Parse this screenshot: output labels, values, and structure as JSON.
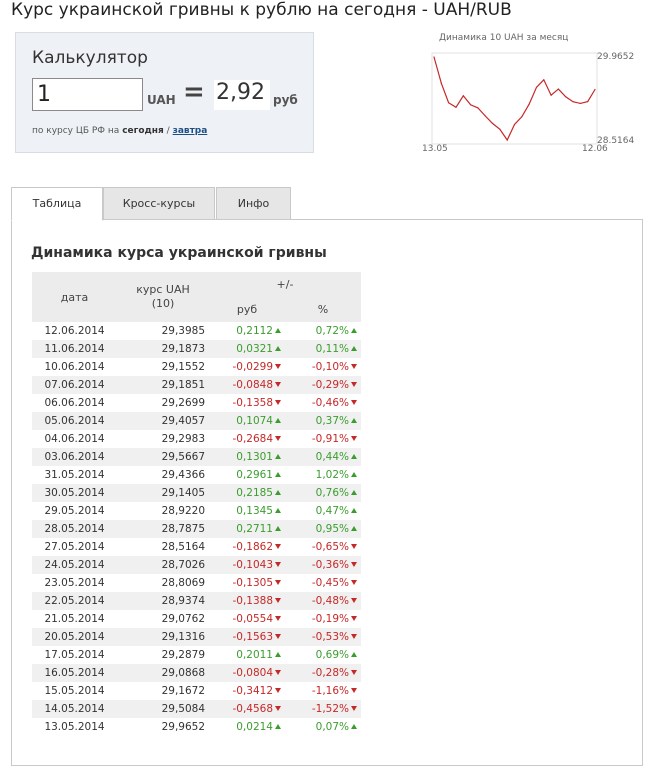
{
  "page": {
    "title": "Курс украинской гривны к рублю на сегодня - UAH/RUB"
  },
  "calculator": {
    "title": "Калькулятор",
    "input_value": "1",
    "from_currency": "UAH",
    "equals": "=",
    "result": "2,92",
    "to_currency": "руб",
    "note_prefix": "по курсу ЦБ РФ на",
    "note_today": "сегодня",
    "note_sep": "/",
    "note_tomorrow_link": "завтра"
  },
  "mini_chart": {
    "title": "Динамика 10 UAH за месяц",
    "y_max_label": "29.9652",
    "y_min_label": "28.5164",
    "x_start_label": "13.05",
    "x_end_label": "12.06",
    "line_color": "#c62828"
  },
  "chart_data": {
    "type": "line",
    "title": "Динамика 10 UAH за месяц",
    "x": [
      "13.05.2014",
      "14.05.2014",
      "15.05.2014",
      "16.05.2014",
      "17.05.2014",
      "20.05.2014",
      "21.05.2014",
      "22.05.2014",
      "23.05.2014",
      "24.05.2014",
      "27.05.2014",
      "28.05.2014",
      "29.05.2014",
      "30.05.2014",
      "31.05.2014",
      "03.06.2014",
      "04.06.2014",
      "05.06.2014",
      "06.06.2014",
      "07.06.2014",
      "10.06.2014",
      "11.06.2014",
      "12.06.2014"
    ],
    "series": [
      {
        "values": [
          29.9652,
          29.5084,
          29.1672,
          29.0868,
          29.2879,
          29.1316,
          29.0762,
          28.9374,
          28.8069,
          28.7026,
          28.5164,
          28.7875,
          28.922,
          29.1405,
          29.4366,
          29.5667,
          29.2983,
          29.4057,
          29.2699,
          29.1851,
          29.1552,
          29.1873,
          29.3985
        ]
      }
    ],
    "ylim": [
      28.5164,
      29.9652
    ],
    "y_tick_labels": [
      "29.9652",
      "28.5164"
    ],
    "x_tick_labels": [
      "13.05",
      "12.06"
    ]
  },
  "tabs": [
    {
      "label": "Таблица",
      "active": true
    },
    {
      "label": "Кросс-курсы",
      "active": false
    },
    {
      "label": "Инфо",
      "active": false
    }
  ],
  "table": {
    "heading": "Динамика курса украинской гривны",
    "col_date": "дата",
    "col_rate_line1": "курс UAH",
    "col_rate_line2": "(10)",
    "col_change": "+/-",
    "col_rub": "руб",
    "col_pct": "%",
    "rows": [
      {
        "date": "12.06.2014",
        "rate": "29,3985",
        "rub": "0,2112",
        "pct": "0,72%",
        "dir": "up"
      },
      {
        "date": "11.06.2014",
        "rate": "29,1873",
        "rub": "0,0321",
        "pct": "0,11%",
        "dir": "up"
      },
      {
        "date": "10.06.2014",
        "rate": "29,1552",
        "rub": "-0,0299",
        "pct": "-0,10%",
        "dir": "down"
      },
      {
        "date": "07.06.2014",
        "rate": "29,1851",
        "rub": "-0,0848",
        "pct": "-0,29%",
        "dir": "down"
      },
      {
        "date": "06.06.2014",
        "rate": "29,2699",
        "rub": "-0,1358",
        "pct": "-0,46%",
        "dir": "down"
      },
      {
        "date": "05.06.2014",
        "rate": "29,4057",
        "rub": "0,1074",
        "pct": "0,37%",
        "dir": "up"
      },
      {
        "date": "04.06.2014",
        "rate": "29,2983",
        "rub": "-0,2684",
        "pct": "-0,91%",
        "dir": "down"
      },
      {
        "date": "03.06.2014",
        "rate": "29,5667",
        "rub": "0,1301",
        "pct": "0,44%",
        "dir": "up"
      },
      {
        "date": "31.05.2014",
        "rate": "29,4366",
        "rub": "0,2961",
        "pct": "1,02%",
        "dir": "up"
      },
      {
        "date": "30.05.2014",
        "rate": "29,1405",
        "rub": "0,2185",
        "pct": "0,76%",
        "dir": "up"
      },
      {
        "date": "29.05.2014",
        "rate": "28,9220",
        "rub": "0,1345",
        "pct": "0,47%",
        "dir": "up"
      },
      {
        "date": "28.05.2014",
        "rate": "28,7875",
        "rub": "0,2711",
        "pct": "0,95%",
        "dir": "up"
      },
      {
        "date": "27.05.2014",
        "rate": "28,5164",
        "rub": "-0,1862",
        "pct": "-0,65%",
        "dir": "down"
      },
      {
        "date": "24.05.2014",
        "rate": "28,7026",
        "rub": "-0,1043",
        "pct": "-0,36%",
        "dir": "down"
      },
      {
        "date": "23.05.2014",
        "rate": "28,8069",
        "rub": "-0,1305",
        "pct": "-0,45%",
        "dir": "down"
      },
      {
        "date": "22.05.2014",
        "rate": "28,9374",
        "rub": "-0,1388",
        "pct": "-0,48%",
        "dir": "down"
      },
      {
        "date": "21.05.2014",
        "rate": "29,0762",
        "rub": "-0,0554",
        "pct": "-0,19%",
        "dir": "down"
      },
      {
        "date": "20.05.2014",
        "rate": "29,1316",
        "rub": "-0,1563",
        "pct": "-0,53%",
        "dir": "down"
      },
      {
        "date": "17.05.2014",
        "rate": "29,2879",
        "rub": "0,2011",
        "pct": "0,69%",
        "dir": "up"
      },
      {
        "date": "16.05.2014",
        "rate": "29,0868",
        "rub": "-0,0804",
        "pct": "-0,28%",
        "dir": "down"
      },
      {
        "date": "15.05.2014",
        "rate": "29,1672",
        "rub": "-0,3412",
        "pct": "-1,16%",
        "dir": "down"
      },
      {
        "date": "14.05.2014",
        "rate": "29,5084",
        "rub": "-0,4568",
        "pct": "-1,52%",
        "dir": "down"
      },
      {
        "date": "13.05.2014",
        "rate": "29,9652",
        "rub": "0,0214",
        "pct": "0,07%",
        "dir": "up"
      }
    ]
  }
}
